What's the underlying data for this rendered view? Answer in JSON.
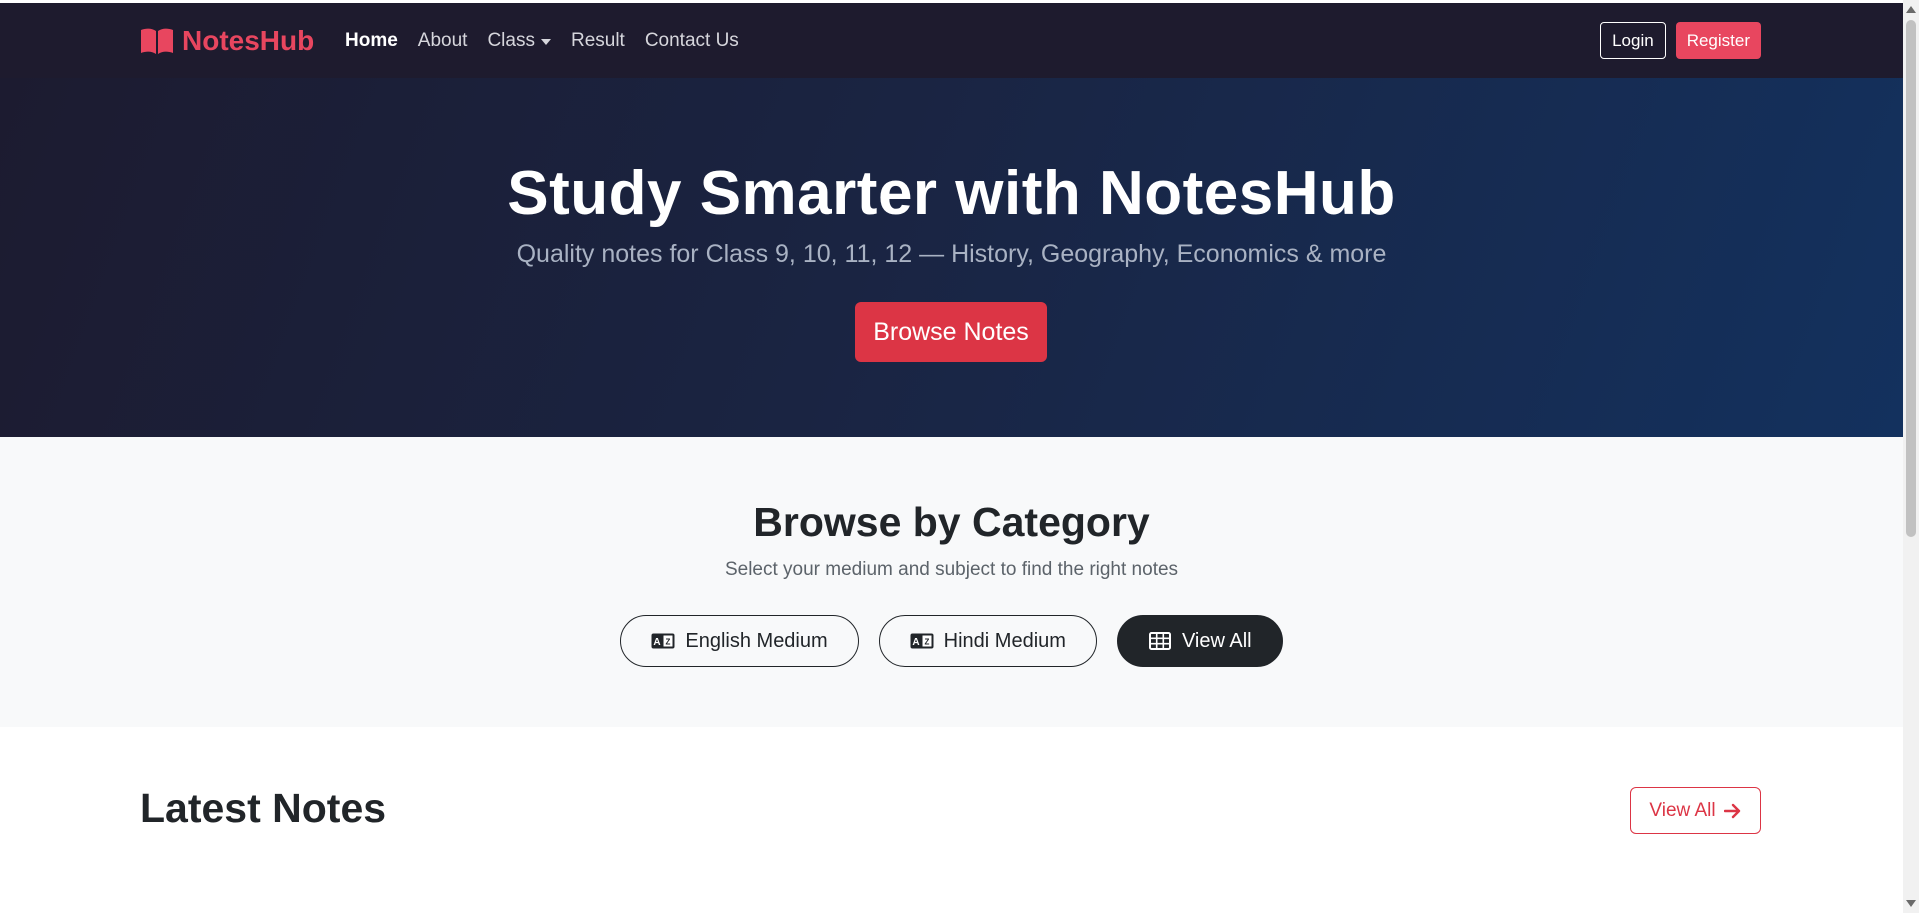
{
  "navbar": {
    "brand": "NotesHub",
    "links": [
      {
        "label": "Home",
        "active": true
      },
      {
        "label": "About"
      },
      {
        "label": "Class"
      },
      {
        "label": "Result"
      },
      {
        "label": "Contact Us"
      }
    ],
    "login_label": "Login",
    "register_label": "Register"
  },
  "hero": {
    "title": "Study Smarter with NotesHub",
    "subtitle": "Quality notes for Class 9, 10, 11, 12 — History, Geography, Economics & more",
    "browse_label": "Browse Notes"
  },
  "category": {
    "title": "Browse by Category",
    "subtitle": "Select your medium and subject to find the right notes",
    "buttons": [
      {
        "label": "English Medium",
        "icon": "language-icon"
      },
      {
        "label": "Hindi Medium",
        "icon": "language-icon"
      },
      {
        "label": "View All",
        "icon": "grid-icon"
      }
    ]
  },
  "latest": {
    "title": "Latest Notes",
    "view_all_label": "View All"
  },
  "colors": {
    "brand": "#e8465f",
    "primary_button": "#dc3545",
    "navbar_bg": "#1e1b2e",
    "hero_start": "#1c1b30",
    "hero_end": "#13315e"
  }
}
